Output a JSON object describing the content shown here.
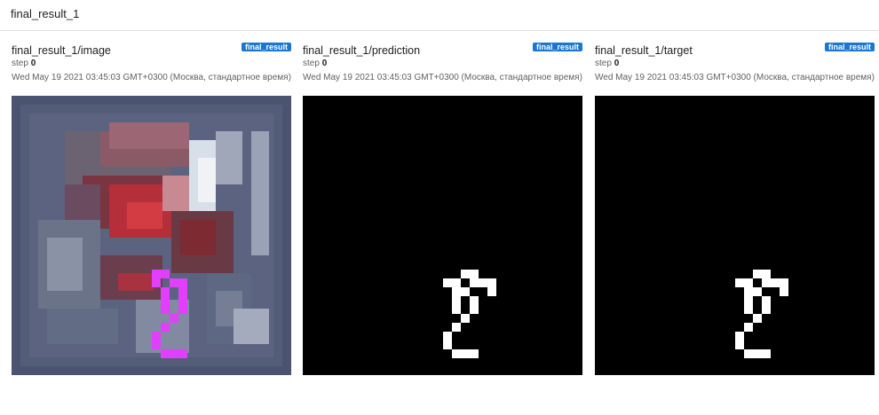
{
  "header": {
    "title": "final_result_1"
  },
  "cards": [
    {
      "title": "final_result_1/image",
      "tag": "final_result",
      "step_label": "step",
      "step_value": "0",
      "timestamp": "Wed May 19 2021 03:45:03 GMT+0300 (Москва, стандартное время)"
    },
    {
      "title": "final_result_1/prediction",
      "tag": "final_result",
      "step_label": "step",
      "step_value": "0",
      "timestamp": "Wed May 19 2021 03:45:03 GMT+0300 (Москва, стандартное время)"
    },
    {
      "title": "final_result_1/target",
      "tag": "final_result",
      "step_label": "step",
      "step_value": "0",
      "timestamp": "Wed May 19 2021 03:45:03 GMT+0300 (Москва, стандартное время)"
    }
  ],
  "colors": {
    "tag_bg": "#1976d2",
    "overlay": "#e040fb",
    "mask_fg": "#ffffff",
    "mask_bg": "#000000"
  }
}
